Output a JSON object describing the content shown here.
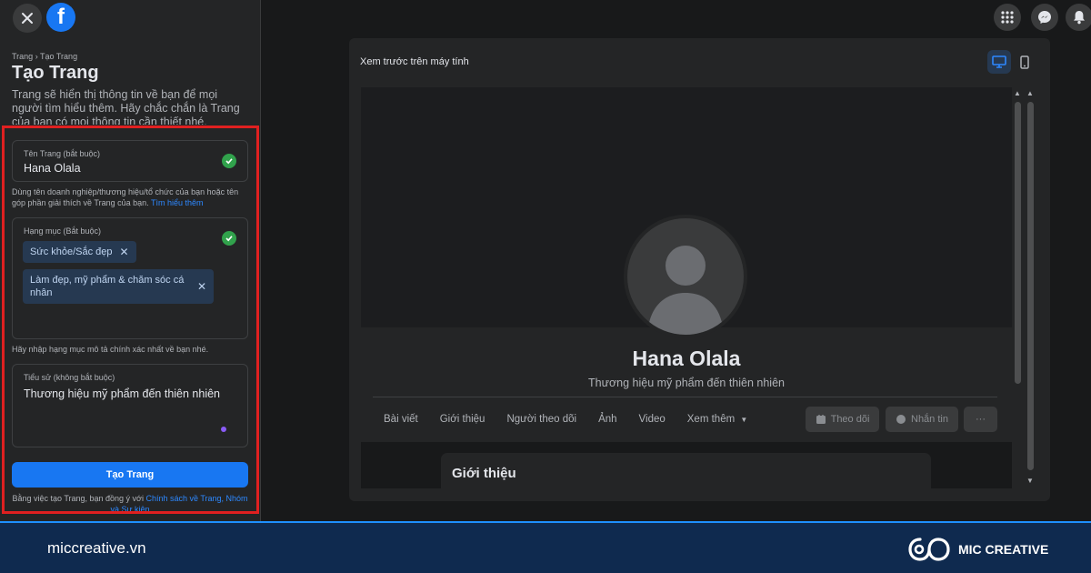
{
  "sidebar": {
    "breadcrumb": {
      "parent": "Trang",
      "separator": "›",
      "current": "Tạo Trang"
    },
    "title": "Tạo Trang",
    "description": "Trang sẽ hiển thị thông tin về bạn để mọi người tìm hiểu thêm. Hãy chắc chắn là Trang của bạn có mọi thông tin cần thiết nhé.",
    "page_name_field": {
      "label": "Tên Trang (bắt buộc)",
      "value": "Hana Olala"
    },
    "page_name_help": "Dùng tên doanh nghiệp/thương hiệu/tổ chức của bạn hoặc tên góp phần giải thích về Trang của bạn.",
    "learn_more_link": "Tìm hiểu thêm",
    "category_field": {
      "label": "Hạng mục (Bắt buộc)",
      "chips": [
        "Sức khỏe/Sắc đẹp",
        "Làm đẹp, mỹ phẩm & chăm sóc cá nhân"
      ]
    },
    "category_help": "Hãy nhập hạng mục mô tả chính xác nhất về bạn nhé.",
    "bio_field": {
      "label": "Tiểu sử (không bắt buộc)",
      "value": "Thương hiệu mỹ phẩm đến thiên nhiên"
    },
    "create_button": "Tạo Trang",
    "legal_prefix": "Bằng việc tạo Trang, bạn đồng ý với",
    "legal_link": "Chính sách về Trang, Nhóm và Sự kiện"
  },
  "preview": {
    "title": "Xem trước trên máy tính",
    "profile": {
      "name": "Hana Olala",
      "bio": "Thương hiệu mỹ phẩm đến thiên nhiên"
    },
    "tabs": [
      "Bài viết",
      "Giới thiệu",
      "Người theo dõi",
      "Ảnh",
      "Video",
      "Xem thêm"
    ],
    "follow_button": "Theo dõi",
    "message_button": "Nhắn tin",
    "more_button": "···",
    "intro_title": "Giới thiệu"
  },
  "footer": {
    "url": "miccreative.vn",
    "brand": "MIC CREATIVE"
  },
  "colors": {
    "accent": "#1877f2",
    "highlight": "#e02020",
    "success": "#31a24c",
    "footer_bg": "#0f2a4f"
  },
  "icons": [
    "close-icon",
    "facebook-logo-icon",
    "check-icon",
    "chip-remove-icon",
    "menu-grid-icon",
    "messenger-icon",
    "notification-bell-icon",
    "desktop-icon",
    "mobile-icon",
    "default-avatar-icon",
    "chevron-down-icon",
    "follow-icon",
    "message-icon",
    "mic-creative-logo-icon"
  ]
}
